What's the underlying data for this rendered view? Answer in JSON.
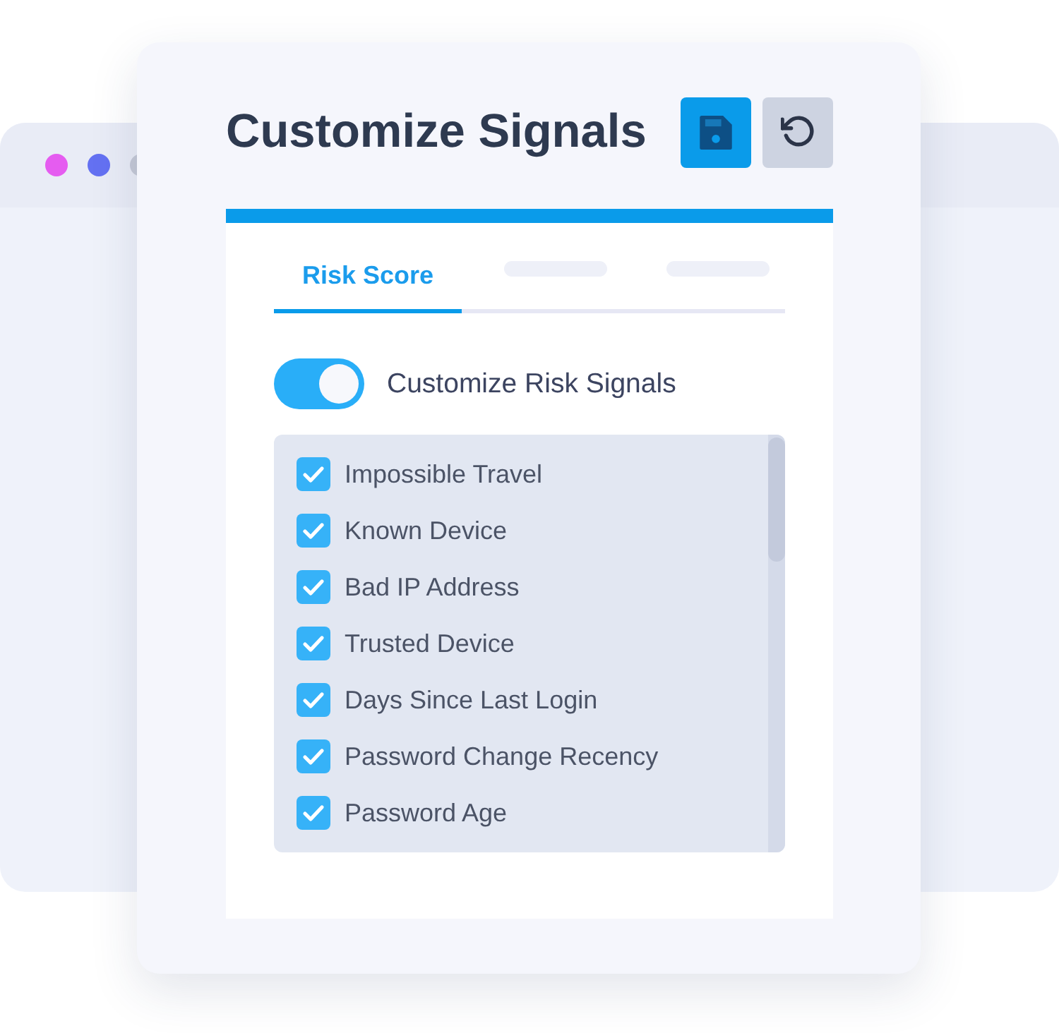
{
  "window": {
    "dots": [
      {
        "color": "#e55cf0"
      },
      {
        "color": "#6471f2"
      },
      {
        "color": "#c5c9d6"
      }
    ]
  },
  "dialog": {
    "title": "Customize Signals",
    "actions": [
      {
        "kind": "save"
      },
      {
        "kind": "reset"
      }
    ]
  },
  "tabs": [
    {
      "kind": "text",
      "label": "Risk Score",
      "selected": true
    },
    {
      "kind": "skeleton",
      "selected": false
    },
    {
      "kind": "skeleton",
      "selected": false
    }
  ],
  "toggle": {
    "label": "Customize Risk Signals",
    "on": true
  },
  "signals": [
    {
      "label": "Impossible Travel",
      "checked": true
    },
    {
      "label": "Known Device",
      "checked": true
    },
    {
      "label": "Bad IP Address",
      "checked": true
    },
    {
      "label": "Trusted Device",
      "checked": true
    },
    {
      "label": "Days Since Last Login",
      "checked": true
    },
    {
      "label": "Password Change Recency",
      "checked": true
    },
    {
      "label": "Password Age",
      "checked": true
    }
  ]
}
